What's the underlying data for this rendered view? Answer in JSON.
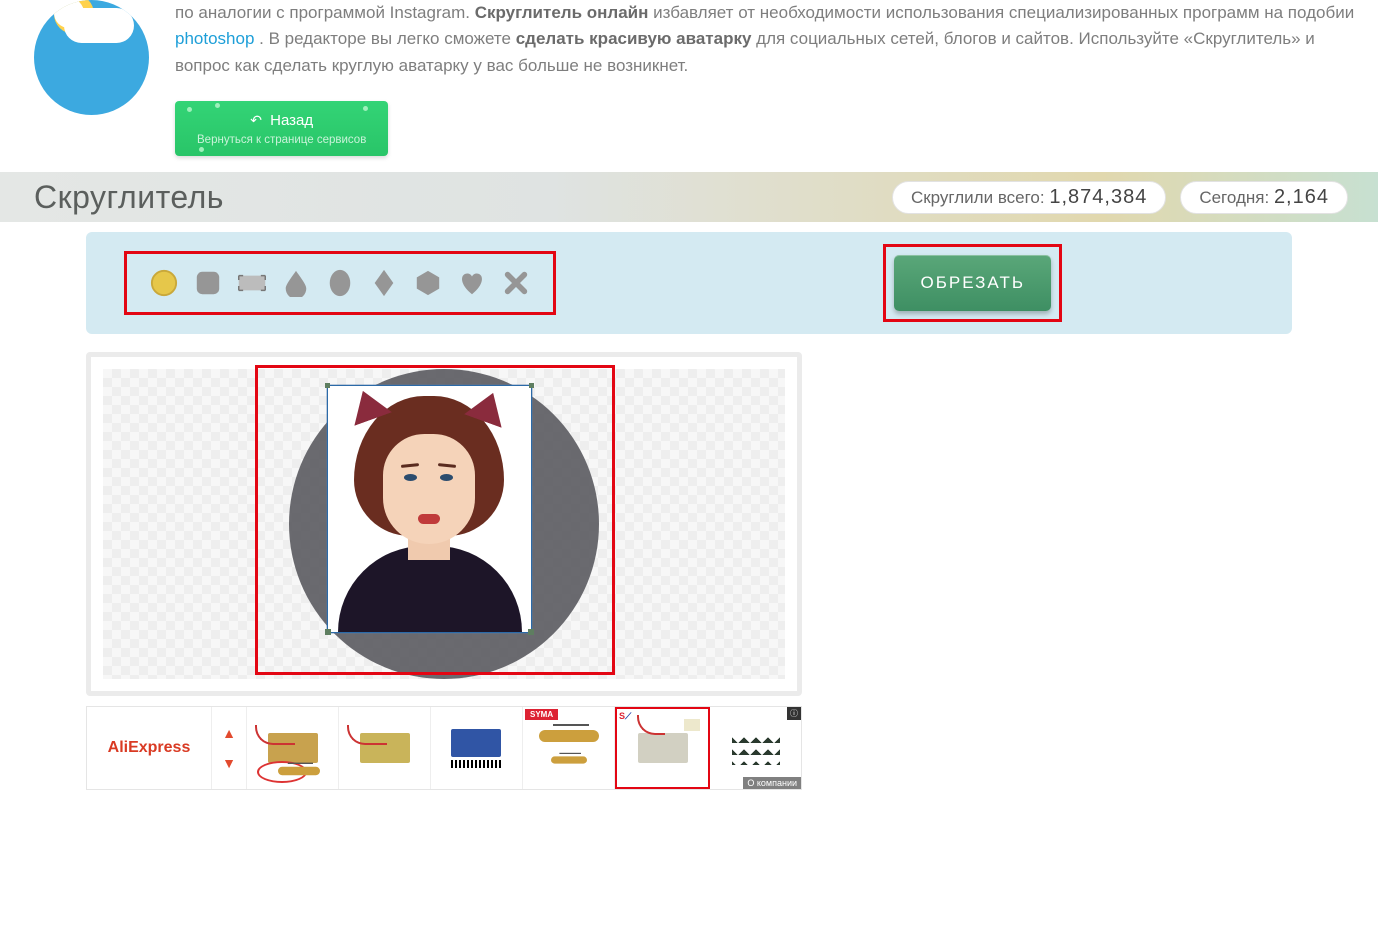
{
  "intro": {
    "line1_a": "по аналогии с программой Instagram. ",
    "line1_b": "Скруглитель онлайн",
    "line1_c": " избавляет от необходимости использования специализированных программ на подобии ",
    "link": "photoshop",
    "line2_a": ". В редакторе вы легко сможете ",
    "line2_b": "сделать красивую аватарку",
    "line2_c": " для социальных сетей, блогов и  сайтов. Используйте «Скруглитель» и вопрос как сделать круглую аватарку у вас больше не возникнет."
  },
  "back": {
    "label": "Назад",
    "sub": "Вернуться к странице сервисов"
  },
  "titlebar": {
    "title": "Скруглитель",
    "total_label": "Скруглили всего: ",
    "total_value": "1,874,384",
    "today_label": "Сегодня: ",
    "today_value": "2,164"
  },
  "crop_button": "ОБРЕЗАТЬ",
  "shapes": [
    "circle",
    "rounded-square",
    "rectangle",
    "drop",
    "oval",
    "diamond",
    "hexagon",
    "heart",
    "cross"
  ],
  "ad": {
    "brand": "AliExpress",
    "info_badge": "ⓘ",
    "caption": "О компании",
    "syma": "SYMA"
  }
}
